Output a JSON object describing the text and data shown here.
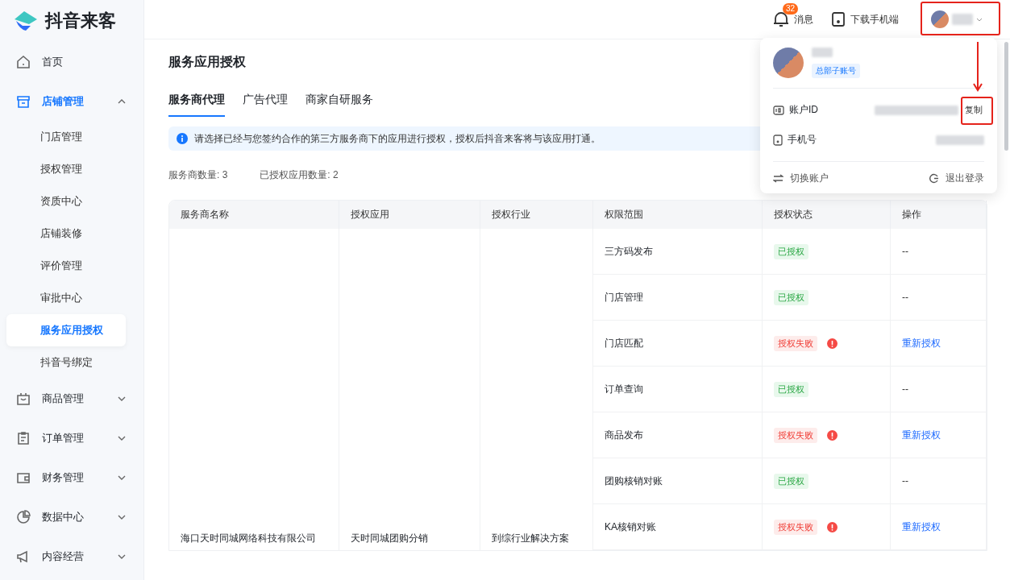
{
  "logo": {
    "text": "抖音来客"
  },
  "sidebar": [
    {
      "label": "首页",
      "kind": "link",
      "selected": false
    },
    {
      "label": "店铺管理",
      "kind": "group",
      "expanded": true,
      "selected": true,
      "children": [
        {
          "label": "门店管理",
          "selected": false
        },
        {
          "label": "授权管理",
          "selected": false
        },
        {
          "label": "资质中心",
          "selected": false
        },
        {
          "label": "店铺装修",
          "selected": false
        },
        {
          "label": "评价管理",
          "selected": false
        },
        {
          "label": "审批中心",
          "selected": false
        },
        {
          "label": "服务应用授权",
          "selected": true
        },
        {
          "label": "抖音号绑定",
          "selected": false
        }
      ]
    },
    {
      "label": "商品管理",
      "kind": "group",
      "expanded": false,
      "selected": false
    },
    {
      "label": "订单管理",
      "kind": "group",
      "expanded": false,
      "selected": false
    },
    {
      "label": "财务管理",
      "kind": "group",
      "expanded": false,
      "selected": false
    },
    {
      "label": "数据中心",
      "kind": "group",
      "expanded": false,
      "selected": false
    },
    {
      "label": "内容经营",
      "kind": "group",
      "expanded": false,
      "selected": false
    }
  ],
  "header": {
    "notifications": {
      "label": "消息",
      "badge": "32"
    },
    "download": {
      "label": "下载手机端"
    }
  },
  "account_menu": {
    "role_tag": "总部子账号",
    "rows": [
      {
        "label": "账户ID",
        "kind": "id",
        "action": "复制"
      },
      {
        "label": "手机号",
        "kind": "phone"
      }
    ],
    "footer": [
      {
        "label": "切换账户",
        "kind": "switch"
      },
      {
        "label": "退出登录",
        "kind": "logout"
      }
    ]
  },
  "page": {
    "title": "服务应用授权",
    "tabs": [
      {
        "label": "服务商代理",
        "selected": true
      },
      {
        "label": "广告代理",
        "selected": false
      },
      {
        "label": "商家自研服务",
        "selected": false
      }
    ],
    "notice": "请选择已经与您签约合作的第三方服务商下的应用进行授权，授权后抖音来客将与该应用打通。",
    "stats": [
      "服务商数量: 3",
      "已授权应用数量: 2"
    ],
    "table": {
      "columns": [
        "服务商名称",
        "授权应用",
        "授权行业",
        "权限范围",
        "授权状态",
        "操作"
      ],
      "provider": {
        "name": "海口天时同城网络科技有限公司",
        "app": "天时同城团购分销",
        "industry": "到综行业解决方案"
      },
      "rows": [
        {
          "scope": "三方码发布",
          "status": {
            "kind": "ok",
            "label": "已授权"
          },
          "action": "--"
        },
        {
          "scope": "门店管理",
          "status": {
            "kind": "ok",
            "label": "已授权"
          },
          "action": "--"
        },
        {
          "scope": "门店匹配",
          "status": {
            "kind": "failed",
            "label": "授权失败"
          },
          "action": "重新授权"
        },
        {
          "scope": "订单查询",
          "status": {
            "kind": "ok",
            "label": "已授权"
          },
          "action": "--"
        },
        {
          "scope": "商品发布",
          "status": {
            "kind": "failed",
            "label": "授权失败"
          },
          "action": "重新授权"
        },
        {
          "scope": "团购核销对账",
          "status": {
            "kind": "ok",
            "label": "已授权"
          },
          "action": "--"
        },
        {
          "scope": "KA核销对账",
          "status": {
            "kind": "failed",
            "label": "授权失败"
          },
          "action": "重新授权"
        }
      ]
    }
  }
}
